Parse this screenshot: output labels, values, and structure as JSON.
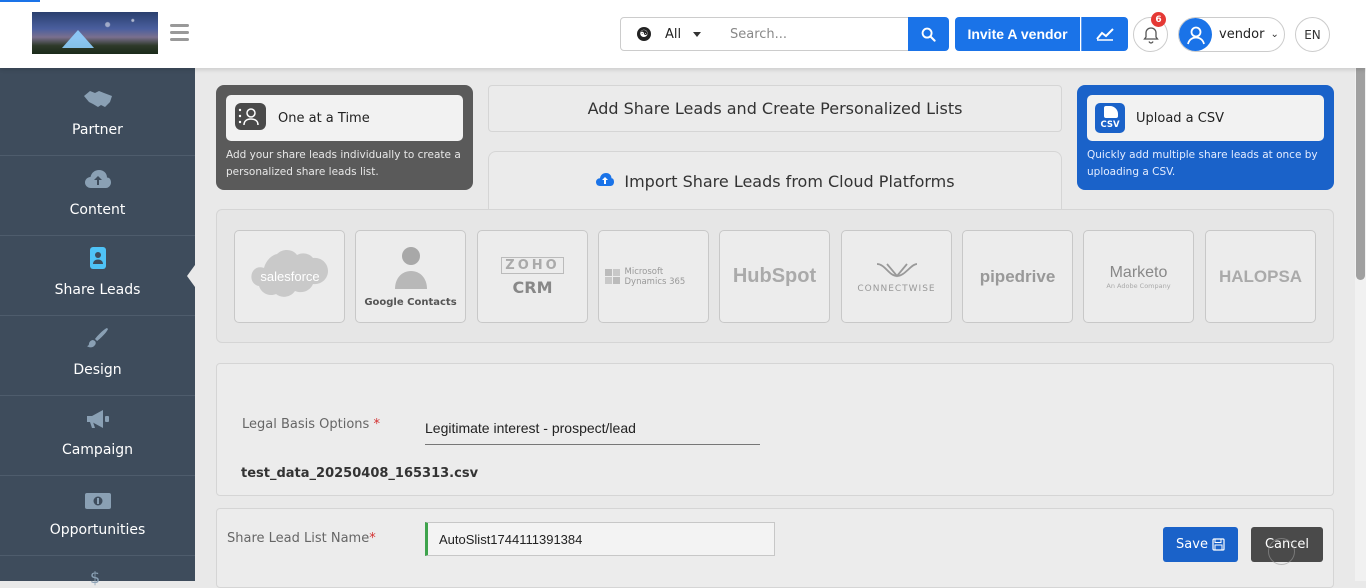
{
  "header": {
    "filter_label": "All",
    "search_placeholder": "Search...",
    "invite_label": "Invite A vendor",
    "notification_count": "6",
    "user_name": "vendor",
    "language": "EN"
  },
  "sidebar": {
    "items": [
      {
        "label": "Partner",
        "icon": "handshake-icon"
      },
      {
        "label": "Content",
        "icon": "cloud-upload-icon"
      },
      {
        "label": "Share Leads",
        "icon": "share-leads-icon",
        "active": true
      },
      {
        "label": "Design",
        "icon": "brush-icon"
      },
      {
        "label": "Campaign",
        "icon": "megaphone-icon"
      },
      {
        "label": "Opportunities",
        "icon": "money-icon"
      }
    ],
    "partial_symbol": "$"
  },
  "cards": {
    "one_at_a_time": {
      "title": "One at a Time",
      "description": "Add your share leads individually to create a personalized share leads list."
    },
    "center_title": "Add Share Leads and Create Personalized Lists",
    "import_title": "Import Share Leads from Cloud Platforms",
    "upload_csv": {
      "title": "Upload a CSV",
      "description": "Quickly add multiple share leads at once by uploading a CSV.",
      "icon_text": "CSV"
    }
  },
  "platforms": [
    {
      "name": "salesforce"
    },
    {
      "name": "Google Contacts"
    },
    {
      "name": "CRM",
      "badge": "ZOHO"
    },
    {
      "name": "Microsoft Dynamics 365"
    },
    {
      "name": "HubSpot"
    },
    {
      "name": "CONNECTWISE"
    },
    {
      "name": "pipedrive"
    },
    {
      "name": "Marketo",
      "sub": "An Adobe Company"
    },
    {
      "name": "HALOPSA"
    }
  ],
  "form": {
    "legal_basis_label": "Legal Basis Options",
    "legal_basis_value": "Legitimate interest - prospect/lead",
    "file_name": "test_data_20250408_165313.csv",
    "list_name_label": "Share Lead List Name",
    "list_name_value": "AutoSlist1744111391384",
    "required_mark": "*",
    "save_label": "Save",
    "cancel_label": "Cancel"
  },
  "colors": {
    "primary": "#1a73e8",
    "sidebar_bg": "#3e4c5c",
    "csv_card": "#1a62c9",
    "one_card": "#5a5a5a",
    "required": "#d32f2f",
    "valid_border": "#3ea34c"
  }
}
